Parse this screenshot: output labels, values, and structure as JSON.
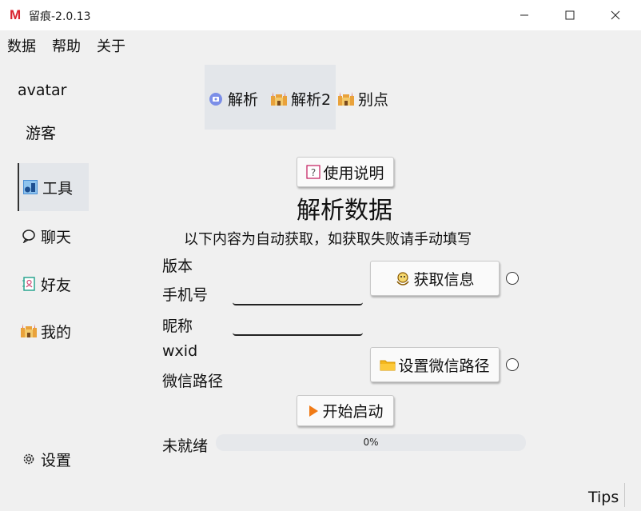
{
  "window": {
    "logo": "M",
    "title": "留痕-2.0.13"
  },
  "menu": {
    "data": "数据",
    "help": "帮助",
    "about": "关于"
  },
  "sidebar": {
    "avatar": "avatar",
    "user": "游客",
    "items": [
      {
        "label": "工具",
        "icon": "tools-icon"
      },
      {
        "label": "聊天",
        "icon": "chat-bubble-icon"
      },
      {
        "label": "好友",
        "icon": "contacts-book-icon"
      },
      {
        "label": "我的",
        "icon": "castle-icon"
      }
    ],
    "settings": "设置"
  },
  "tabs": [
    {
      "label": "解析",
      "icon": "disk-icon"
    },
    {
      "label": "解析2",
      "icon": "castle-icon"
    },
    {
      "label": "别点",
      "icon": "castle-icon"
    }
  ],
  "main": {
    "help_button": "使用说明",
    "title": "解析数据",
    "subtitle": "以下内容为自动获取，如获取失败请手动填写",
    "labels": {
      "version": "版本",
      "phone": "手机号",
      "nickname": "昵称",
      "wxid": "wxid",
      "path": "微信路径"
    },
    "inputs": {
      "phone": "",
      "nickname": ""
    },
    "get_info_button": "获取信息",
    "set_path_button": "设置微信路径",
    "start_button": "开始启动",
    "status": "未就绪",
    "progress_value": 0,
    "progress_text": "0%"
  },
  "footer": {
    "tips": "Tips"
  },
  "colors": {
    "logo": "#d9232e",
    "active_bg": "#e3e6ea",
    "start_icon": "#f07a16",
    "folder_icon": "#f4b71c"
  }
}
